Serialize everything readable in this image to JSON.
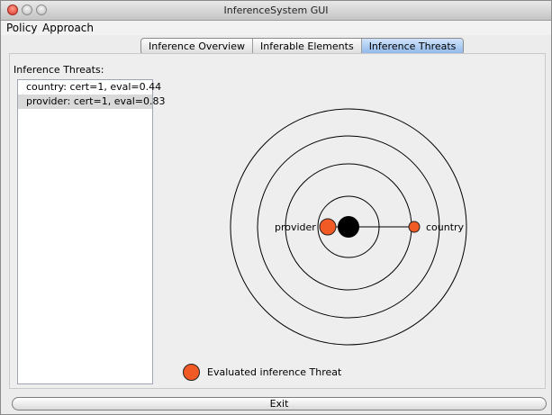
{
  "window": {
    "title": "InferenceSystem GUI"
  },
  "menu": {
    "items": [
      "Policy",
      "Approach"
    ]
  },
  "tabs": [
    {
      "label": "Inference Overview",
      "active": false
    },
    {
      "label": "Inferable Elements",
      "active": false
    },
    {
      "label": "Inference Threats",
      "active": true
    }
  ],
  "threats": {
    "heading": "Inference Threats:",
    "items": [
      {
        "label": "country:  cert=1, eval=0.44"
      },
      {
        "label": "provider:  cert=1, eval=0.83"
      }
    ]
  },
  "visualization": {
    "center_color": "#000000",
    "threat_color": "#f15a24",
    "nodes": [
      {
        "label": "provider"
      },
      {
        "label": "country"
      }
    ]
  },
  "legend": {
    "label": "Evaluated inference Threat"
  },
  "exit_label": "Exit",
  "colors": {
    "accent_tab": "#8fb7ea",
    "threat": "#f15a24"
  }
}
